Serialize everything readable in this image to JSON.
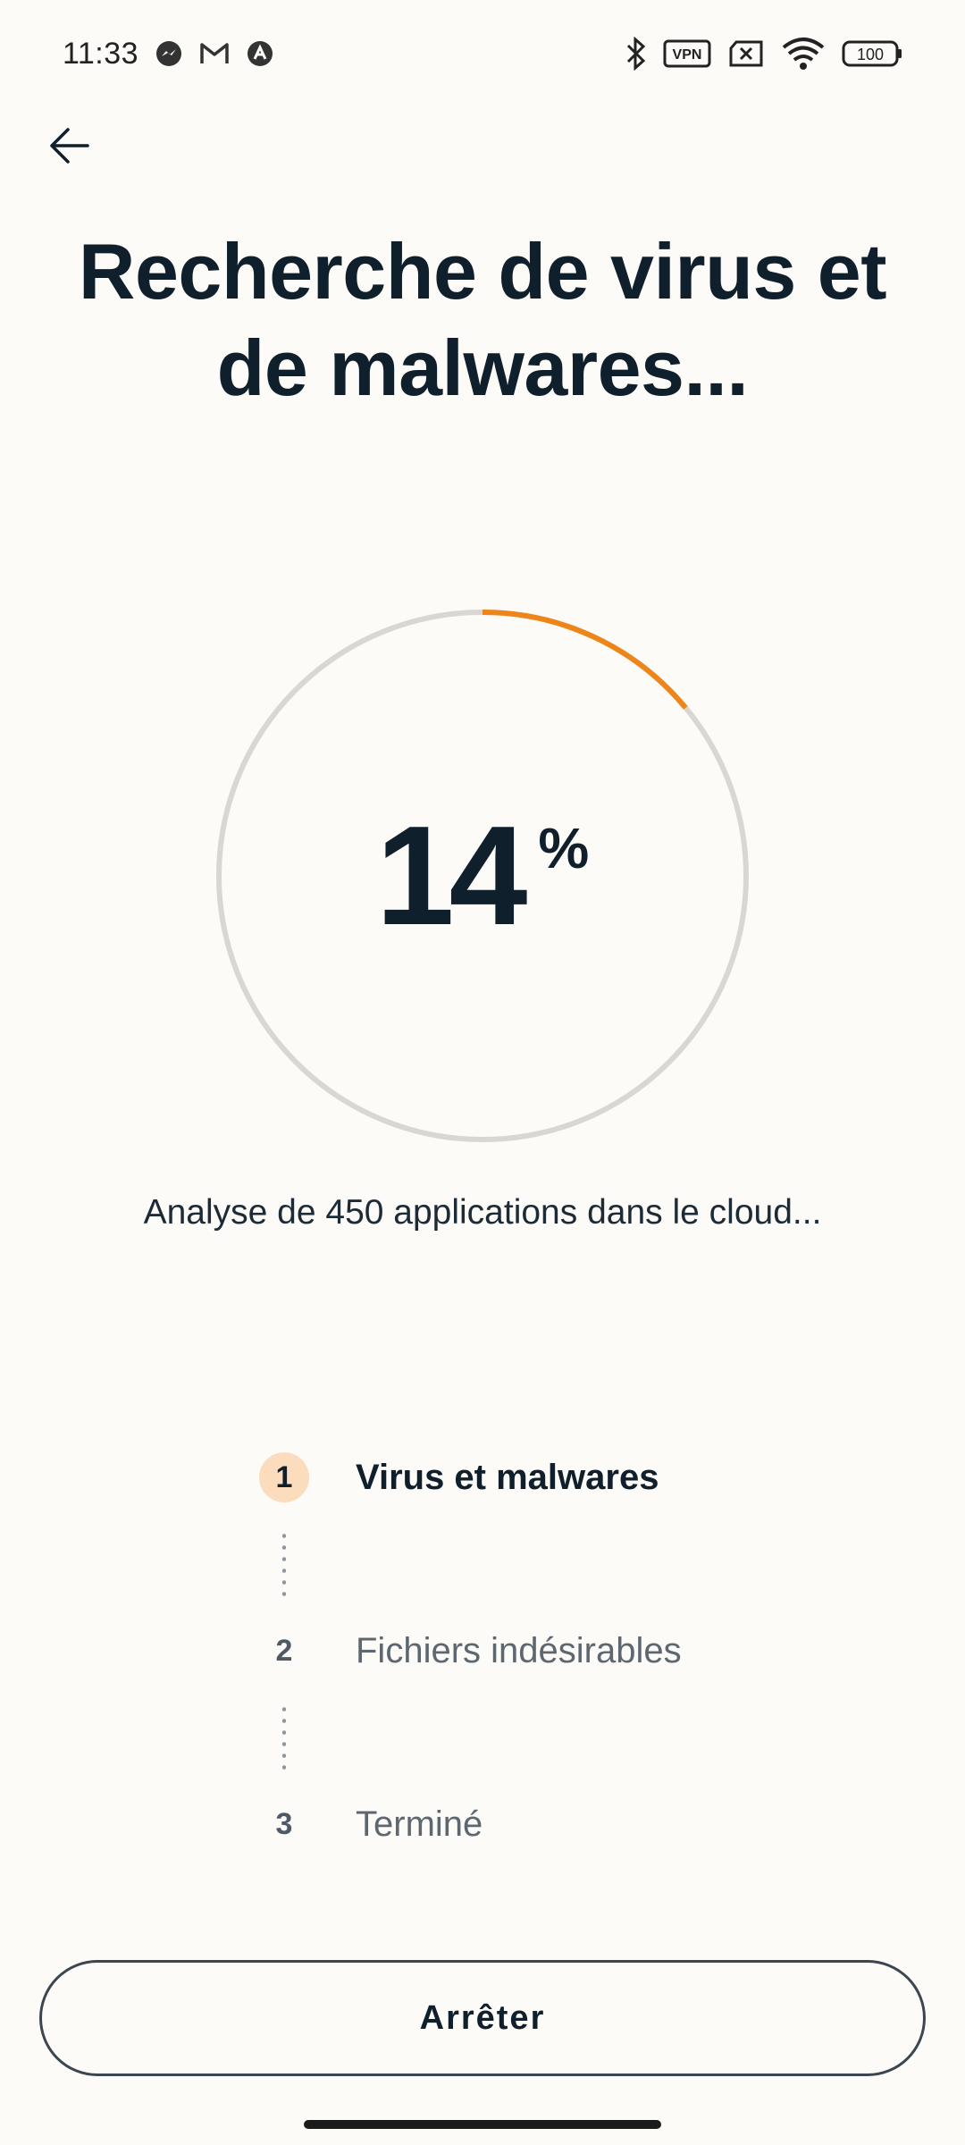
{
  "status_bar": {
    "time": "11:33",
    "left_icons": [
      "messenger-icon",
      "gmail-icon",
      "app-icon"
    ],
    "right_icons": [
      "bluetooth-icon",
      "vpn-icon",
      "no-sim-icon",
      "wifi-icon",
      "battery-icon"
    ],
    "vpn_label": "VPN",
    "battery_level": "100"
  },
  "header": {
    "back_icon": "arrow-left-icon",
    "title": "Recherche de virus et de malwares..."
  },
  "progress": {
    "percent_value": "14",
    "percent_sign": "%",
    "fraction": 0.14,
    "accent_color": "#ee8519",
    "track_color": "#d9d7d4"
  },
  "scan_status": "Analyse de 450 applications dans le cloud...",
  "steps": [
    {
      "number": "1",
      "label": "Virus et malwares",
      "active": true
    },
    {
      "number": "2",
      "label": "Fichiers indésirables",
      "active": false
    },
    {
      "number": "3",
      "label": "Terminé",
      "active": false
    }
  ],
  "actions": {
    "stop_label": "Arrêter"
  }
}
